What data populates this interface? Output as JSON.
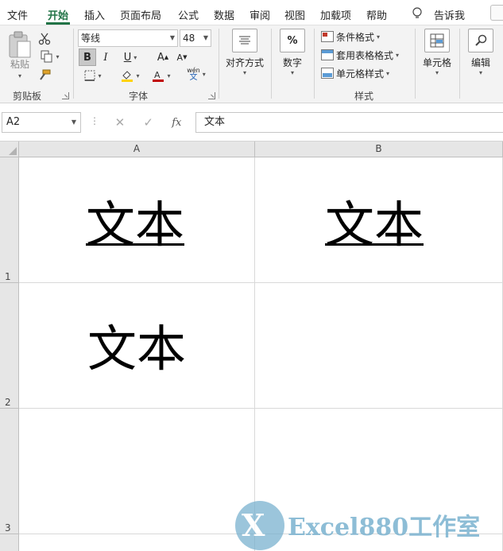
{
  "menu": {
    "tabs": [
      "文件",
      "开始",
      "插入",
      "页面布局",
      "公式",
      "数据",
      "审阅",
      "视图",
      "加载项",
      "帮助"
    ],
    "active_tab": "开始",
    "tell_me": "告诉我"
  },
  "ribbon": {
    "clipboard": {
      "paste_label": "粘贴",
      "group_label": "剪贴板"
    },
    "font": {
      "font_name": "等线",
      "font_size": "48",
      "bold": "B",
      "italic": "I",
      "underline": "U",
      "grow": "A",
      "shrink": "A",
      "phonetic_top": "wén",
      "phonetic_bottom": "文",
      "group_label": "字体",
      "fill_color": "#ffd300",
      "font_color": "#c00000"
    },
    "alignment": {
      "label": "对齐方式"
    },
    "number": {
      "label": "数字",
      "icon_text": "%"
    },
    "styles": {
      "conditional": "条件格式",
      "table_format": "套用表格格式",
      "cell_styles": "单元格样式",
      "group_label": "样式"
    },
    "cells": {
      "label": "单元格"
    },
    "editing": {
      "label": "编辑"
    }
  },
  "formula_bar": {
    "name_box": "A2",
    "fx": "fx",
    "content": "文本"
  },
  "sheet": {
    "columns": [
      "A",
      "B"
    ],
    "rows": [
      "1",
      "2",
      "3"
    ],
    "cells": {
      "A1": "文本",
      "B1": "文本",
      "A2": "文本"
    }
  },
  "watermark": {
    "logo_letter": "X",
    "text": "Excel880工作室"
  }
}
